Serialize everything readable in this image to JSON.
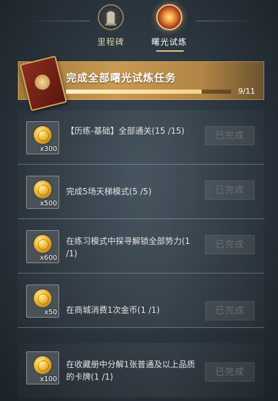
{
  "tabs": [
    {
      "label": "里程碑",
      "icon": "milestone-tablet-icon",
      "active": false
    },
    {
      "label": "曙光试炼",
      "icon": "dawn-trial-orb-icon",
      "active": true
    }
  ],
  "banner": {
    "title": "完成全部曙光试炼任务",
    "progress_text": "9/11",
    "progress": 0.82,
    "icon": "red-book-icon"
  },
  "tasks": [
    {
      "desc": "【历练-基础】全部通关(15 /15)",
      "qty": "x300",
      "button": "已完成"
    },
    {
      "desc": "完成5场天梯模式(5 /5)",
      "qty": "x500",
      "button": "已完成"
    },
    {
      "desc": "在练习模式中探寻解锁全部势力(1 /1)",
      "qty": "x600",
      "button": "已完成"
    },
    {
      "desc": "在商城消费1次金币(1 /1)",
      "qty": "x50",
      "button": "已完成"
    },
    {
      "desc": "在收藏册中分解1张普通及以上品质的卡牌(1 /1)",
      "qty": "x100",
      "button": "已完成"
    }
  ],
  "colors": {
    "accent": "#c99a52",
    "active_tab": "#e9c88a"
  }
}
